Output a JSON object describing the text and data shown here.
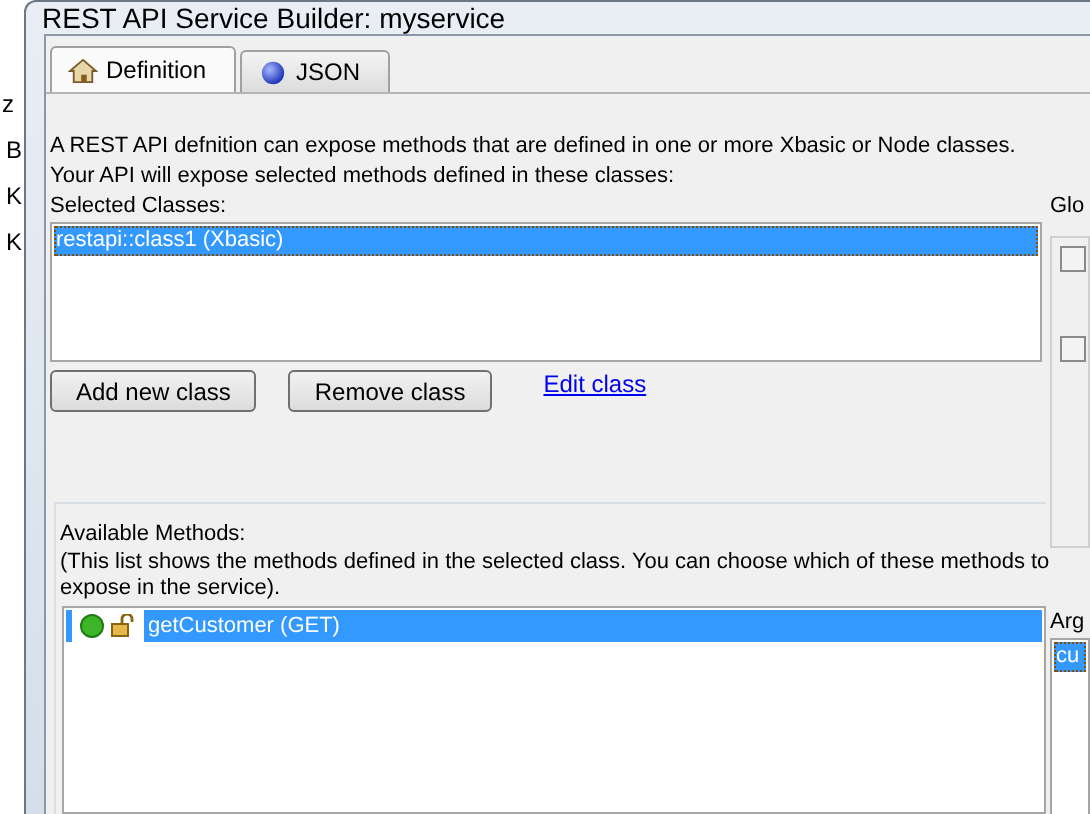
{
  "background_window": {
    "texts": [
      "z",
      "B",
      "K",
      "K"
    ]
  },
  "window": {
    "title": "REST API Service Builder: myservice"
  },
  "tabs": [
    {
      "label": "Definition",
      "selected": true,
      "kind": "home"
    },
    {
      "label": "JSON",
      "selected": false,
      "kind": "ball"
    }
  ],
  "definition": {
    "intro_lines": [
      "A REST API defnition can expose methods that are defined in one or more Xbasic or Node classes.",
      "Your API will expose selected methods defined in these classes:"
    ],
    "selected_classes_label": "Selected Classes:",
    "classes": [
      {
        "label": "restapi::class1 (Xbasic)",
        "selected": true
      }
    ],
    "buttons": [
      "Add new class",
      "Remove class"
    ],
    "edit_link": "Edit class"
  },
  "global_panel": {
    "label": "Glo",
    "checkboxes": [
      {
        "checked": false
      },
      {
        "checked": false
      }
    ]
  },
  "methods": {
    "label": "Available Methods:",
    "note_lines": [
      "(This list shows the methods defined in the selected class. You can choose which of these methods to",
      "expose in the service)."
    ],
    "items": [
      {
        "label": "getCustomer (GET)",
        "selected": true
      }
    ]
  },
  "arguments": {
    "label": "Arg",
    "items": [
      {
        "label": "cu",
        "selected": true
      }
    ]
  }
}
